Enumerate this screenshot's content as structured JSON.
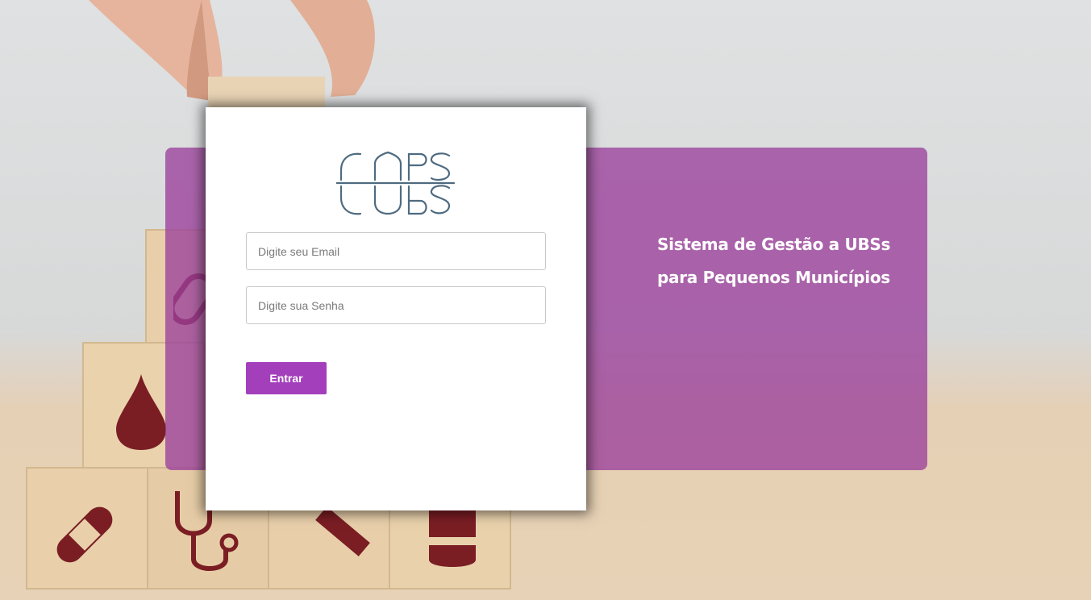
{
  "login": {
    "email_placeholder": "Digite seu Email",
    "password_placeholder": "Digite sua Senha",
    "submit_label": "Entrar"
  },
  "panel": {
    "line1": "Sistema de Gestão a UBSs",
    "line2": "para Pequenos Municípios"
  },
  "colors": {
    "panel": "#9b409b",
    "button": "#a43fbc",
    "logo": "#4f6b80",
    "icons": "#7a1e24"
  },
  "icons": [
    "pill-icon",
    "blood-drop-icon",
    "bandage-icon",
    "stethoscope-icon",
    "syringe-icon",
    "medicine-bottle-icon"
  ]
}
